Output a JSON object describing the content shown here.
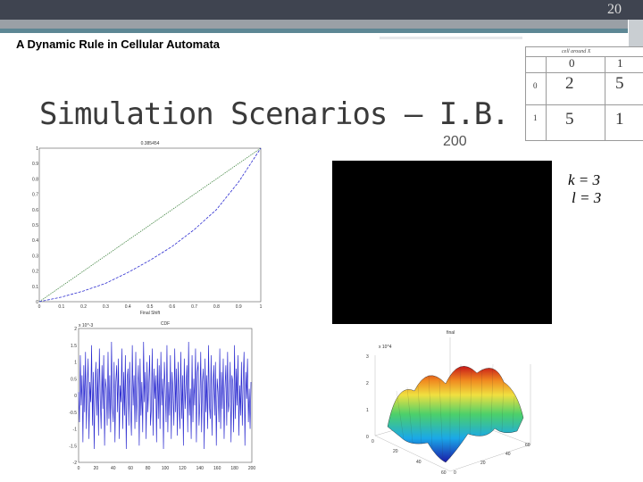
{
  "header": {
    "page_number": "20",
    "section_title": "A Dynamic Rule in Cellular Automata"
  },
  "slide": {
    "title": "Simulation Scenarios – I.B.",
    "frame_count": "200"
  },
  "rule_table": {
    "header": "cell around X",
    "col_labels": [
      "0",
      "1"
    ],
    "row_labels": [
      "0",
      "1"
    ],
    "cells": [
      [
        "2",
        "5"
      ],
      [
        "5",
        "1"
      ]
    ]
  },
  "params": {
    "k": "k = 3",
    "l": "l = 3"
  },
  "chart_data": [
    {
      "type": "line",
      "title": "0.385454",
      "xlabel": "Final Shift",
      "xlim": [
        0,
        1
      ],
      "ylim": [
        0,
        1
      ],
      "x_ticks": [
        "0",
        "0.1",
        "0.2",
        "0.3",
        "0.4",
        "0.5",
        "0.6",
        "0.7",
        "0.8",
        "0.9",
        "1"
      ],
      "y_ticks": [
        "0",
        "0.1",
        "0.2",
        "0.3",
        "0.4",
        "0.5",
        "0.6",
        "0.7",
        "0.8",
        "0.9",
        "1"
      ],
      "colors": [
        "#4b8b4b",
        "#2b2bd0"
      ],
      "series": [
        {
          "x": [
            0,
            0.1,
            0.2,
            0.3,
            0.4,
            0.5,
            0.6,
            0.7,
            0.8,
            0.9,
            1
          ],
          "values": [
            0,
            0.1,
            0.2,
            0.3,
            0.4,
            0.5,
            0.6,
            0.7,
            0.8,
            0.9,
            1
          ]
        },
        {
          "x": [
            0,
            0.1,
            0.2,
            0.3,
            0.4,
            0.5,
            0.6,
            0.7,
            0.8,
            0.9,
            1
          ],
          "values": [
            0,
            0.03,
            0.07,
            0.12,
            0.19,
            0.27,
            0.36,
            0.47,
            0.6,
            0.78,
            1
          ]
        }
      ]
    },
    {
      "type": "line",
      "title": "CDF",
      "y_exponent": "x 10^-3",
      "xlim": [
        0,
        200
      ],
      "ylim": [
        -2,
        2
      ],
      "x_ticks": [
        "0",
        "20",
        "40",
        "60",
        "80",
        "100",
        "120",
        "140",
        "160",
        "180",
        "200"
      ],
      "y_ticks": [
        "-2",
        "-1.5",
        "-1",
        "-0.5",
        "0",
        "0.5",
        "1",
        "1.5",
        "2"
      ],
      "colors": [
        "#2b2bd0"
      ],
      "series": [
        {
          "x_start": 0,
          "x_step": 1,
          "values": [
            0.1,
            -0.8,
            1.2,
            -0.3,
            0.6,
            -1.4,
            0.9,
            -0.5,
            1.3,
            -1.0,
            0.2,
            1.1,
            -1.3,
            0.4,
            -0.2,
            1.5,
            -0.9,
            0.7,
            -1.6,
            0.3,
            1.0,
            -0.6,
            0.8,
            -1.2,
            1.4,
            -0.1,
            -1.0,
            0.9,
            -0.4,
            1.2,
            -1.5,
            0.5,
            0.2,
            -0.9,
            1.3,
            -0.7,
            0.6,
            -1.1,
            1.6,
            -0.3,
            -0.8,
            1.0,
            -1.4,
            0.4,
            0.9,
            -0.5,
            1.1,
            -1.3,
            0.3,
            -0.2,
            1.4,
            -1.0,
            0.7,
            -0.6,
            1.2,
            -1.6,
            0.5,
            0.8,
            -0.9,
            1.0,
            -0.4,
            -1.2,
            1.5,
            -0.3,
            0.6,
            -1.0,
            1.3,
            -0.8,
            0.2,
            0.9,
            -1.5,
            1.1,
            -0.6,
            0.4,
            -1.1,
            1.6,
            -0.2,
            0.7,
            -1.3,
            1.0,
            -0.5,
            0.3,
            1.2,
            -0.9,
            -0.4,
            1.4,
            -1.2,
            0.8,
            -0.1,
            0.6,
            -1.4,
            1.1,
            -0.7,
            0.9,
            -1.0,
            1.3,
            -0.3,
            0.5,
            -1.6,
            1.0,
            0.2,
            -0.8,
            1.5,
            -1.1,
            0.4,
            -0.6,
            1.2,
            -1.3,
            0.7,
            0.1,
            -0.9,
            1.4,
            -0.5,
            0.8,
            -1.2,
            1.0,
            -0.2,
            -1.0,
            1.3,
            -0.7,
            0.6,
            -1.5,
            1.1,
            -0.4,
            0.3,
            0.9,
            -1.1,
            1.6,
            -0.6,
            0.2,
            -1.3,
            1.2,
            -0.8,
            0.5,
            -0.3,
            1.4,
            -1.4,
            0.7,
            1.0,
            -0.9,
            -0.2,
            1.3,
            -1.1,
            0.4,
            0.8,
            -1.6,
            1.1,
            -0.5,
            0.6,
            -1.0,
            1.5,
            -0.3,
            -0.7,
            1.2,
            -1.2,
            0.3,
            0.9,
            -0.6,
            1.0,
            -1.5,
            0.5,
            0.1,
            -0.8,
            1.4,
            -1.0,
            0.7,
            -0.4,
            1.1,
            -1.3,
            0.2,
            0.9,
            -0.9,
            1.3,
            -0.5,
            -0.2,
            1.0,
            -1.4,
            0.6,
            0.4,
            -1.1,
            1.5,
            -0.7,
            0.8,
            -0.3,
            1.2,
            -1.2,
            0.3,
            -0.6,
            1.0,
            -0.9,
            0.5,
            1.3,
            -1.5,
            0.7,
            -0.1,
            1.1,
            -0.8,
            0.2,
            -1.0,
            0.4
          ]
        }
      ]
    }
  ],
  "surface_plot": {
    "title": "final",
    "z_exponent": "x 10^4",
    "x_ticks": [
      "0",
      "20",
      "40",
      "60"
    ],
    "y_ticks": [
      "0",
      "20",
      "40",
      "60"
    ],
    "z_ticks": [
      "0",
      "1",
      "2",
      "3"
    ]
  }
}
